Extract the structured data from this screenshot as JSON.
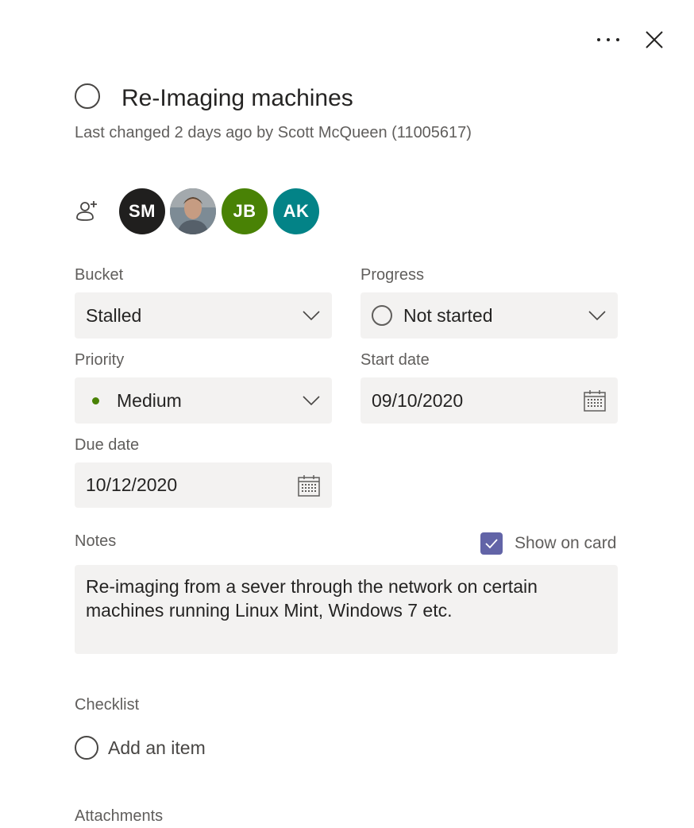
{
  "task": {
    "title": "Re-Imaging machines",
    "last_changed": "Last changed 2 days ago by Scott McQueen (11005617)"
  },
  "assignees": [
    {
      "initials": "SM",
      "color": "#201f1e"
    },
    {
      "initials": "",
      "color": "#8a7a6e",
      "kind": "photo"
    },
    {
      "initials": "JB",
      "color": "#498205"
    },
    {
      "initials": "AK",
      "color": "#038387"
    }
  ],
  "fields": {
    "bucket": {
      "label": "Bucket",
      "value": "Stalled"
    },
    "progress": {
      "label": "Progress",
      "value": "Not started"
    },
    "priority": {
      "label": "Priority",
      "value": "Medium",
      "dot_color": "#498205"
    },
    "start_date": {
      "label": "Start date",
      "value": "09/10/2020"
    },
    "due_date": {
      "label": "Due date",
      "value": "10/12/2020"
    }
  },
  "notes": {
    "label": "Notes",
    "show_on_card_label": "Show on card",
    "show_on_card_checked": true,
    "text": "Re-imaging from a sever through the network on certain machines running Linux Mint, Windows 7 etc."
  },
  "checklist": {
    "label": "Checklist",
    "add_placeholder": "Add an item"
  },
  "attachments": {
    "label": "Attachments"
  },
  "colors": {
    "accent": "#6264a7",
    "field_bg": "#f3f2f1",
    "label": "#605e5c"
  },
  "icons": {
    "more": "more-horizontal-icon",
    "close": "close-icon",
    "assign": "add-person-icon",
    "dropdown": "chevron-down-icon",
    "calendar": "calendar-icon"
  }
}
